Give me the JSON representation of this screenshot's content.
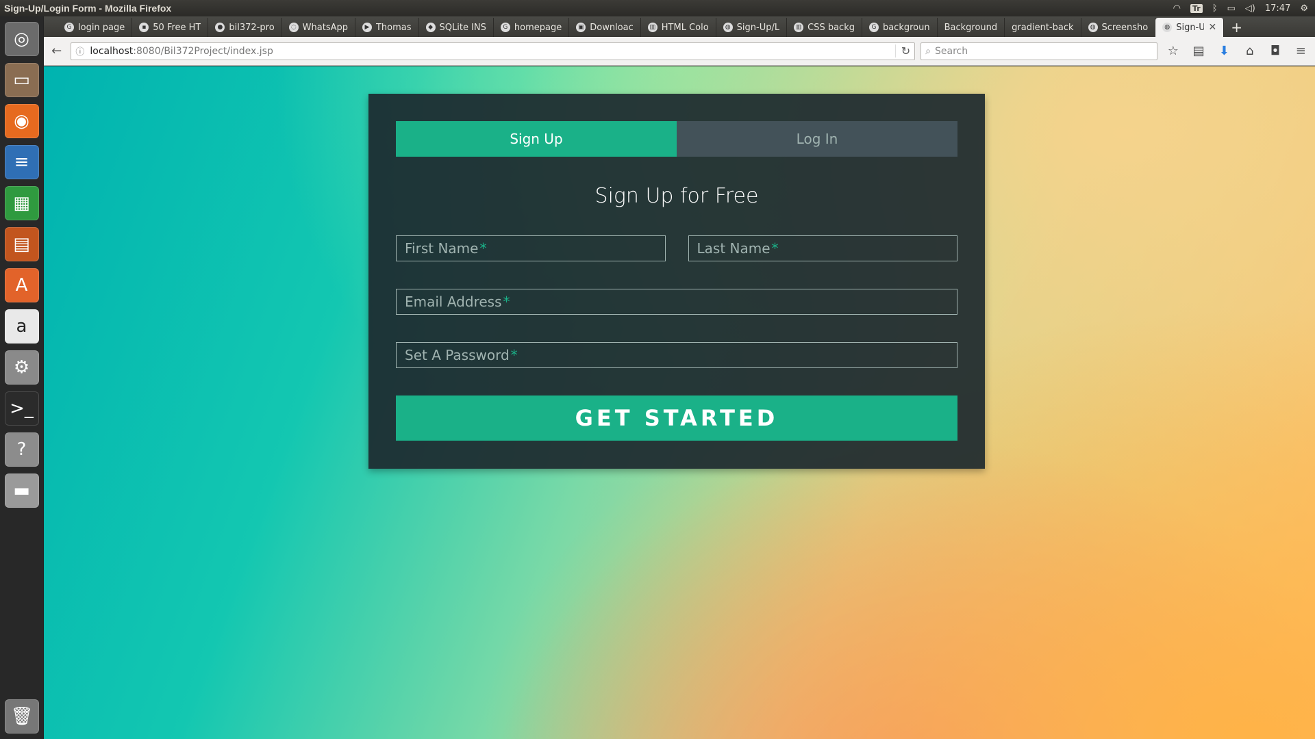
{
  "os": {
    "window_title": "Sign-Up/Login Form - Mozilla Firefox",
    "clock": "17:47",
    "keyboard_layout": "Tr",
    "launcher": [
      {
        "name": "dash-icon",
        "glyph": "◎",
        "color": "#6b6b6b"
      },
      {
        "name": "files-icon",
        "glyph": "▭",
        "color": "#8a6d52"
      },
      {
        "name": "firefox-icon",
        "glyph": "◉",
        "color": "#e66a1f"
      },
      {
        "name": "writer-icon",
        "glyph": "≡",
        "color": "#2f6fb5"
      },
      {
        "name": "calc-icon",
        "glyph": "▦",
        "color": "#2f9a3f"
      },
      {
        "name": "impress-icon",
        "glyph": "▤",
        "color": "#c2551e"
      },
      {
        "name": "software-center-icon",
        "glyph": "A",
        "color": "#e2632a"
      },
      {
        "name": "amazon-icon",
        "glyph": "a",
        "color": "#e9e9e9"
      },
      {
        "name": "settings-icon",
        "glyph": "⚙",
        "color": "#8a8a8a"
      },
      {
        "name": "terminal-icon",
        "glyph": ">_",
        "color": "#2b2b2b"
      },
      {
        "name": "help-icon",
        "glyph": "?",
        "color": "#8c8c8c"
      },
      {
        "name": "drive-icon",
        "glyph": "▬",
        "color": "#9a9a9a"
      }
    ],
    "trash_icon": "trash-icon"
  },
  "browser": {
    "tabs": [
      {
        "label": "login page",
        "favicon": "G"
      },
      {
        "label": "50 Free HT",
        "favicon": "▪"
      },
      {
        "label": "bil372-pro",
        "favicon": "●"
      },
      {
        "label": "WhatsApp",
        "favicon": "◌"
      },
      {
        "label": "Thomas",
        "favicon": "▶"
      },
      {
        "label": "SQLite INS",
        "favicon": "◆"
      },
      {
        "label": "homepage",
        "favicon": "G"
      },
      {
        "label": "Downloac",
        "favicon": "▣"
      },
      {
        "label": "HTML Colo",
        "favicon": "▥"
      },
      {
        "label": "Sign-Up/L",
        "favicon": "◍"
      },
      {
        "label": "CSS backg",
        "favicon": "▥"
      },
      {
        "label": "backgroun",
        "favicon": "G"
      },
      {
        "label": "Background",
        "favicon": ""
      },
      {
        "label": "gradient-back",
        "favicon": ""
      },
      {
        "label": "Screensho",
        "favicon": "◍"
      }
    ],
    "active_tab": {
      "label": "Sign-Up",
      "favicon": "◍"
    },
    "url_host": "localhost",
    "url_rest": ":8080/Bil372Project/index.jsp",
    "search_placeholder": "Search"
  },
  "form": {
    "tab_signup": "Sign Up",
    "tab_login": "Log In",
    "heading": "Sign Up for Free",
    "first_name": "First Name",
    "last_name": "Last Name",
    "email": "Email Address",
    "password": "Set A Password",
    "required_mark": "*",
    "submit": "GET STARTED"
  },
  "colors": {
    "accent": "#1ab188",
    "card": "#1c282e",
    "muted": "#a0b3b0"
  }
}
